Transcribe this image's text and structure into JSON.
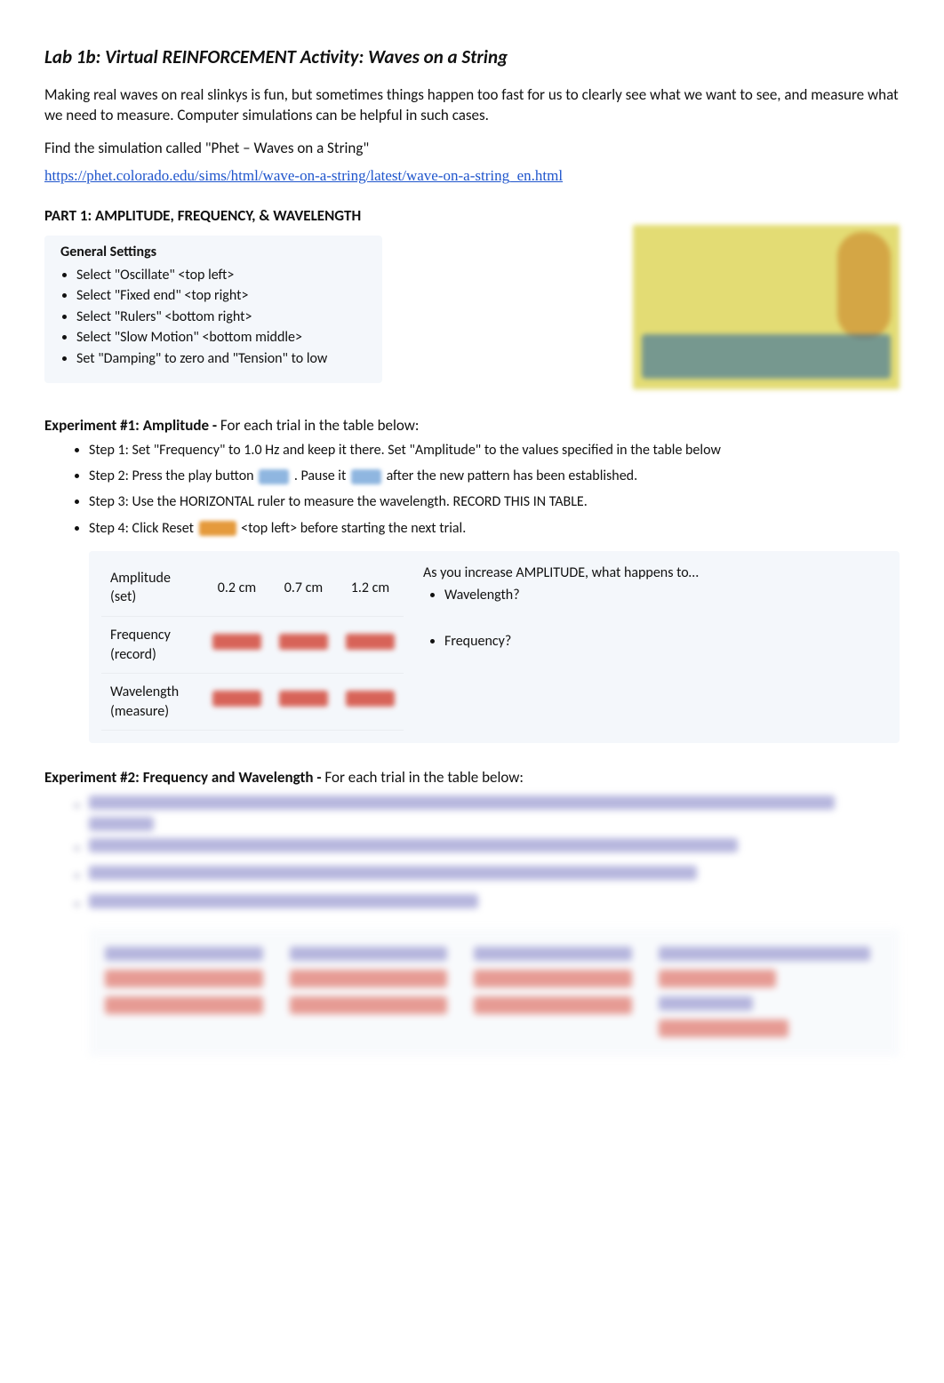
{
  "title": "Lab 1b: Virtual REINFORCEMENT Activity: Waves on a String",
  "intro": "Making real waves on real slinkys is fun, but sometimes things happen too fast for us to clearly see what we want to see, and measure what we need to measure.  Computer simulations can be helpful in such cases.",
  "find_sim": "Find the simulation called \"Phet – Waves on a String\"",
  "sim_url": "https://phet.colorado.edu/sims/html/wave-on-a-string/latest/wave-on-a-string_en.html",
  "part1_heading": "PART 1: AMPLITUDE, FREQUENCY, & WAVELENGTH",
  "general_settings": {
    "heading": "General Settings",
    "items": [
      "Select \"Oscillate\" <top left>",
      "Select \"Fixed end\" <top right>",
      "Select \"Rulers\" <bottom right>",
      "Select \"Slow Motion\" <bottom middle>",
      "Set \"Damping\" to zero and \"Tension\" to low"
    ]
  },
  "exp1": {
    "heading_bold": "Experiment #1: Amplitude - ",
    "heading_rest": "For each trial in the table below:",
    "steps": {
      "s1": "Step 1: Set \"Frequency\" to 1.0 Hz and keep it there. Set \"Amplitude\" to the values specified in the table below",
      "s2a": "Step 2: Press the play button",
      "s2b": ".       Pause it",
      "s2c": "after the new pattern has been established.",
      "s3": "Step 3: Use the HORIZONTAL ruler to measure the wavelength.  RECORD THIS IN TABLE.",
      "s4a": "Step 4: Click Reset",
      "s4b": "<top left> before starting the next trial."
    },
    "table": {
      "row_labels": [
        "Amplitude (set)",
        "Frequency (record)",
        "Wavelength (measure)"
      ],
      "col_headers": [
        "0.2 cm",
        "0.7 cm",
        "1.2 cm"
      ]
    },
    "questions": {
      "lead": "As you increase AMPLITUDE, what happens to…",
      "items": [
        "Wavelength?",
        "Frequency?"
      ]
    }
  },
  "exp2": {
    "heading_bold": "Experiment #2: Frequency and Wavelength  -  ",
    "heading_rest": "For each trial in the table below:"
  }
}
